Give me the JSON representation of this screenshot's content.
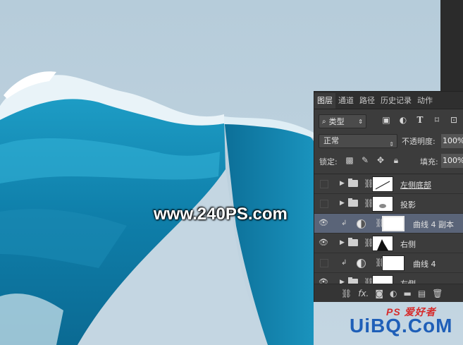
{
  "watermark": "www.240PS.com",
  "brand": {
    "text": "UiBQ.CoM",
    "sub": "PS 爱好者"
  },
  "panel": {
    "tabs": [
      "图层",
      "通道",
      "路径",
      "历史记录",
      "动作"
    ],
    "active_tab": 0,
    "filter": {
      "label": "类型"
    },
    "filter_icons": [
      "image-filter-icon",
      "adjustment-filter-icon",
      "type-filter-icon",
      "shape-filter-icon",
      "smart-object-filter-icon"
    ],
    "blend_mode": "正常",
    "opacity_label": "不透明度:",
    "opacity_value": "100%",
    "lock_label": "锁定:",
    "fill_label": "填充:",
    "fill_value": "100%",
    "layers": [
      {
        "name": "左侧底部",
        "type": "group",
        "visible": false,
        "selected": false
      },
      {
        "name": "投影",
        "type": "group",
        "visible": false,
        "selected": false
      },
      {
        "name": "曲线 4 副本",
        "type": "adjustment",
        "visible": true,
        "selected": true
      },
      {
        "name": "右侧",
        "type": "group",
        "visible": true,
        "selected": false
      },
      {
        "name": "曲线 4",
        "type": "adjustment",
        "visible": false,
        "selected": false
      },
      {
        "name": "左侧",
        "type": "group",
        "visible": true,
        "selected": false
      }
    ],
    "bottom_icons": [
      "link-icon",
      "fx-icon",
      "mask-icon",
      "adjustment-icon",
      "folder-icon",
      "new-layer-icon",
      "trash-icon"
    ],
    "fx_label": "fx."
  }
}
